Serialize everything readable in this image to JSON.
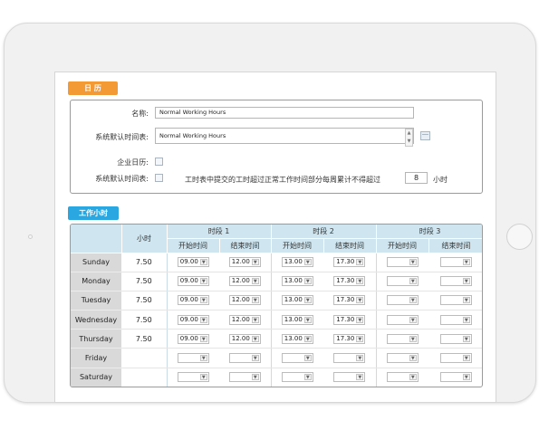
{
  "calendar": {
    "section_title": "日 历",
    "name_label": "名称:",
    "name_value": "Normal Working Hours",
    "default_timesheet_label": "系统默认时间表:",
    "default_timesheet_value": "Normal Working Hours",
    "company_calendar_label": "企业日历:",
    "company_calendar_checked": false,
    "default_timesheet_check_label": "系统默认时间表:",
    "default_timesheet_checked": false,
    "overtime_prefix": "工时表中提交的工时超过正常工作时间部分每周累计不得超过",
    "overtime_value": "8",
    "overtime_unit": "小时"
  },
  "work_hours": {
    "section_title": "工作小时",
    "hours_header": "小时",
    "periods": [
      {
        "label": "时段 1"
      },
      {
        "label": "时段 2"
      },
      {
        "label": "时段 3"
      }
    ],
    "start_header": "开始时间",
    "end_header": "结束时间",
    "rows": [
      {
        "day": "Sunday",
        "hours": "7.50",
        "p1_start": "09.00",
        "p1_end": "12.00",
        "p2_start": "13.00",
        "p2_end": "17.30",
        "p3_start": "",
        "p3_end": ""
      },
      {
        "day": "Monday",
        "hours": "7.50",
        "p1_start": "09.00",
        "p1_end": "12.00",
        "p2_start": "13.00",
        "p2_end": "17.30",
        "p3_start": "",
        "p3_end": ""
      },
      {
        "day": "Tuesday",
        "hours": "7.50",
        "p1_start": "09.00",
        "p1_end": "12.00",
        "p2_start": "13.00",
        "p2_end": "17.30",
        "p3_start": "",
        "p3_end": ""
      },
      {
        "day": "Wednesday",
        "hours": "7.50",
        "p1_start": "09.00",
        "p1_end": "12.00",
        "p2_start": "13.00",
        "p2_end": "17.30",
        "p3_start": "",
        "p3_end": ""
      },
      {
        "day": "Thursday",
        "hours": "7.50",
        "p1_start": "09.00",
        "p1_end": "12.00",
        "p2_start": "13.00",
        "p2_end": "17.30",
        "p3_start": "",
        "p3_end": ""
      },
      {
        "day": "Friday",
        "hours": "",
        "p1_start": "",
        "p1_end": "",
        "p2_start": "",
        "p2_end": "",
        "p3_start": "",
        "p3_end": ""
      },
      {
        "day": "Saturday",
        "hours": "",
        "p1_start": "",
        "p1_end": "",
        "p2_start": "",
        "p2_end": "",
        "p3_start": "",
        "p3_end": ""
      }
    ]
  },
  "icons": {
    "dropdown_arrow": "chevron-down-icon",
    "spinner": "spinner-icon",
    "calendar_picker": "calendar-icon"
  },
  "colors": {
    "calendar_tag": "#f49a35",
    "hours_tag": "#2aa7e0",
    "table_header": "#cfe6f1",
    "day_cell": "#d9d9d9"
  }
}
